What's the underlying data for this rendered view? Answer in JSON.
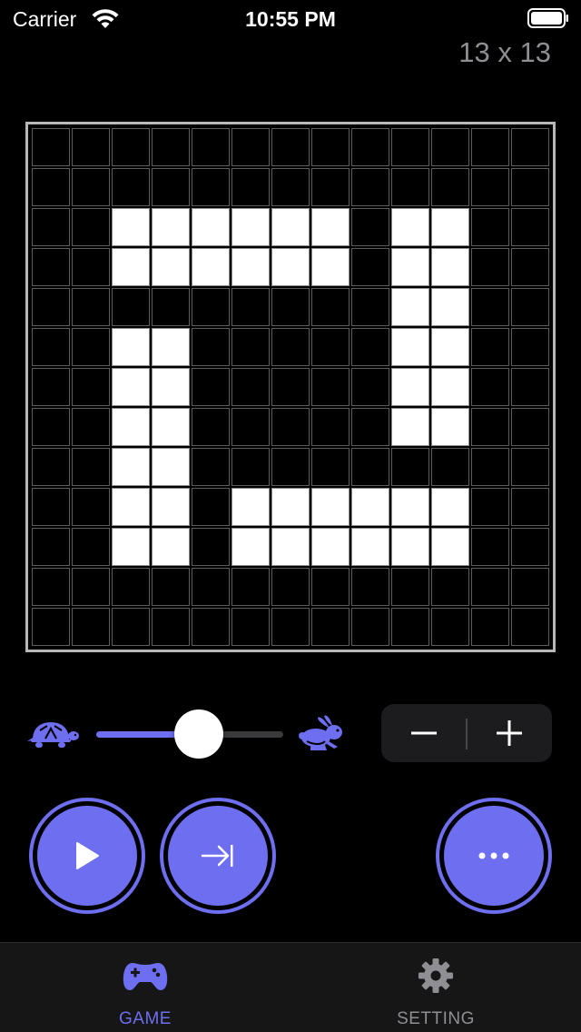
{
  "status_bar": {
    "carrier": "Carrier",
    "time": "10:55 PM"
  },
  "grid_size_label": "13 x 13",
  "board": {
    "rows": 13,
    "cols": 13,
    "cells": [
      "0000000000000",
      "0000000000000",
      "0011111101100",
      "0011111101100",
      "0000000001100",
      "0011000001100",
      "0011000001100",
      "0011000001100",
      "0011000000000",
      "0011011111100",
      "0011011111100",
      "0000000000000",
      "0000000000000"
    ]
  },
  "speed": {
    "level": 0.55,
    "slow_icon": "turtle-icon",
    "fast_icon": "rabbit-icon"
  },
  "stepper": {
    "minus_icon": "minus-icon",
    "plus_icon": "plus-icon"
  },
  "controls": {
    "play_icon": "play-icon",
    "step_icon": "step-forward-icon",
    "more_icon": "ellipsis-icon"
  },
  "tabs": [
    {
      "label": "GAME",
      "icon": "gamepad-icon",
      "active": true
    },
    {
      "label": "SETTING",
      "icon": "gear-icon",
      "active": false
    }
  ],
  "colors": {
    "accent": "#6e6ef0",
    "background": "#000000",
    "alive_cell": "#ffffff",
    "inactive_tab": "#8e8e93"
  }
}
